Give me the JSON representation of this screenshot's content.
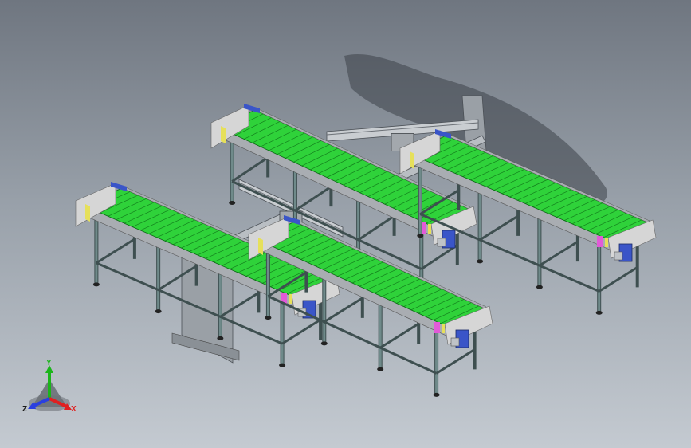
{
  "viewport": {
    "background_top": "#6f7680",
    "background_bottom": "#c4cad1"
  },
  "model": {
    "description_visible": false,
    "conveyors": [
      {
        "id": "conveyor-back-left"
      },
      {
        "id": "conveyor-back-right"
      },
      {
        "id": "conveyor-front-left"
      },
      {
        "id": "conveyor-front-right"
      }
    ],
    "gantries": [
      {
        "id": "gantry-rear"
      },
      {
        "id": "gantry-front"
      }
    ],
    "colors": {
      "belt": "#2fd23a",
      "belt_slat_line": "#0d6b16",
      "frame": "#6f8a8a",
      "frame_dark": "#3e4f50",
      "rail": "#a9adb2",
      "end_guard": "#d6d6d6",
      "accent_yellow": "#e6e05a",
      "accent_magenta": "#e25ad8",
      "motor_blue": "#3a55c8",
      "shadow": "#3d4249"
    }
  },
  "triad": {
    "y_label": "Y",
    "x_label": "X",
    "z_label": "Z",
    "y_color": "#1bb51b",
    "x_color": "#e02020",
    "z_color": "#2a3fe0"
  }
}
